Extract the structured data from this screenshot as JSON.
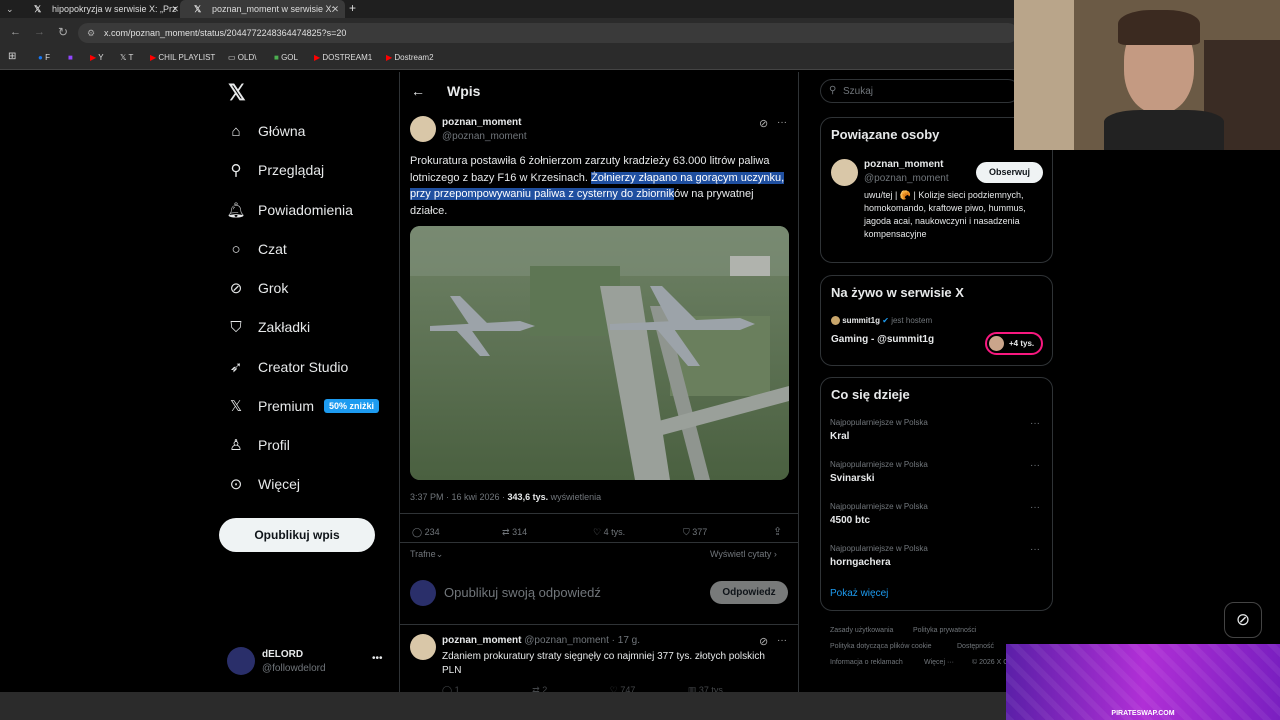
{
  "browser": {
    "tabs": [
      {
        "title": "hipopokryzja w serwisie X: „Prz"
      },
      {
        "title": "poznan_moment w serwisie X: "
      }
    ],
    "new_tab": "+",
    "url": "x.com/poznan_moment/status/2044772248364474825?s=20",
    "bookmarks": [
      "F",
      "Y",
      "T",
      "CHIL PLAYLIST",
      "OLD\\",
      "GOL",
      "DOSTREAM1",
      "Dostream2"
    ]
  },
  "nav": {
    "items": [
      {
        "label": "Główna",
        "icon": "home-icon"
      },
      {
        "label": "Przeglądaj",
        "icon": "search-icon"
      },
      {
        "label": "Powiadomienia",
        "icon": "bell-icon"
      },
      {
        "label": "Czat",
        "icon": "chat-icon"
      },
      {
        "label": "Grok",
        "icon": "grok-icon"
      },
      {
        "label": "Zakładki",
        "icon": "bookmark-icon"
      },
      {
        "label": "Creator Studio",
        "icon": "rocket-icon"
      },
      {
        "label": "Premium",
        "icon": "x-icon"
      },
      {
        "label": "Profil",
        "icon": "person-icon"
      },
      {
        "label": "Więcej",
        "icon": "more-circle-icon"
      }
    ],
    "premium_badge": "50% zniżki",
    "publish_label": "Opublikuj wpis",
    "account": {
      "name": "dELORD",
      "handle": "@followdelord"
    }
  },
  "post_header": {
    "title": "Wpis"
  },
  "post": {
    "author_name": "poznan_moment",
    "author_handle": "@poznan_moment",
    "text_plain_1": "Prokuratura postawiła 6 żołnierzom zarzuty kradzieży 63.000 litrów paliwa lotniczego z bazy F16 w Krzesinach. ",
    "text_highlight": "Żołnierzy złapano na gorącym uczynku, przy przepompowywaniu paliwa z cysterny do zbiornik",
    "text_plain_2": "ów na prywatnej działce.",
    "timestamp": "3:37 PM · 16 kwi 2026 · ",
    "views_count": "343,6 tys.",
    "views_label": " wyświetlenia",
    "replies": "234",
    "reposts": "314",
    "likes": "4 tys.",
    "bookmarks": "377",
    "sort_label": "Trafne",
    "quotes_label": "Wyświetl cytaty ›"
  },
  "reply_box": {
    "placeholder": "Opublikuj swoją odpowiedź",
    "button": "Odpowiedz"
  },
  "reply_post": {
    "author_name": "poznan_moment",
    "author_handle": "@poznan_moment · 17 g.",
    "text": "Zdaniem prokuratury straty sięgnęły co najmniej 377 tys. złotych polskich PLN",
    "replies": "1",
    "reposts": "2",
    "likes": "747",
    "views": "37 tys."
  },
  "search": {
    "placeholder": "Szukaj"
  },
  "related": {
    "title": "Powiązane osoby",
    "name": "poznan_moment",
    "handle": "@poznan_moment",
    "follow_label": "Obserwuj",
    "bio": "uwu/tej | 🥐 | Kolizje sieci podziemnych, homokomando, kraftowe piwo, hummus, jagoda acai, naukowczyni i nasadzenia kompensacyjne"
  },
  "live": {
    "title": "Na żywo w serwisie X",
    "host_name": "summit1g",
    "host_suffix": "jest hostem",
    "stream_title": "Gaming - @summit1g",
    "viewers": "+4 tys."
  },
  "trending": {
    "title": "Co się dzieje",
    "items": [
      {
        "category": "Najpopularniejsze w Polska",
        "name": "Kral"
      },
      {
        "category": "Najpopularniejsze w Polska",
        "name": "Svinarski"
      },
      {
        "category": "Najpopularniejsze w Polska",
        "name": "4500 btc"
      },
      {
        "category": "Najpopularniejsze w Polska",
        "name": "horngachera"
      }
    ],
    "show_more": "Pokaż więcej"
  },
  "footer": {
    "links": [
      "Zasady użytkowania",
      "Polityka prywatności",
      "Polityka dotycząca plików cookie",
      "Dostępność",
      "Informacja o reklamach",
      "Więcej ···",
      "© 2026 X Co"
    ]
  },
  "overlay": {
    "banner_text": "PIRATESWAP.COM"
  },
  "colors": {
    "accent": "#1d9bf0",
    "highlight": "#1f4fa0",
    "background": "#000000",
    "banner": "#8a2be2"
  }
}
